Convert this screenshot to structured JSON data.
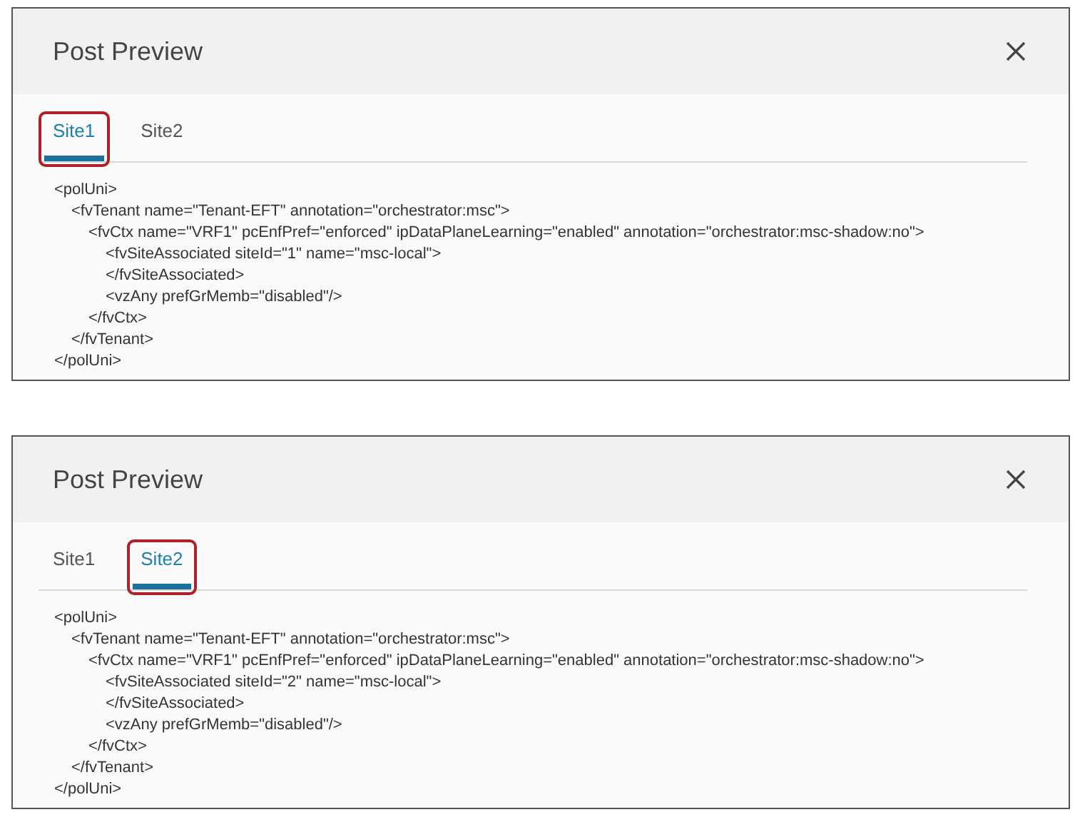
{
  "dialogs": [
    {
      "title": "Post Preview",
      "tabs": [
        {
          "label": "Site1",
          "selected": true,
          "highlighted": true
        },
        {
          "label": "Site2",
          "selected": false,
          "highlighted": false
        }
      ],
      "code": [
        {
          "text": "<polUni>",
          "children": [
            {
              "text": "<fvTenant name=\"Tenant-EFT\" annotation=\"orchestrator:msc\">",
              "children": [
                {
                  "text": "<fvCtx name=\"VRF1\" pcEnfPref=\"enforced\" ipDataPlaneLearning=\"enabled\" annotation=\"orchestrator:msc-shadow:no\">",
                  "children": [
                    {
                      "text": "<fvSiteAssociated siteId=\"1\" name=\"msc-local\">"
                    },
                    {
                      "text": "</fvSiteAssociated>"
                    },
                    {
                      "text": "<vzAny prefGrMemb=\"disabled\"/>"
                    }
                  ]
                },
                {
                  "text": "</fvCtx>"
                }
              ]
            },
            {
              "text": "</fvTenant>"
            }
          ]
        },
        {
          "text": "</polUni>"
        }
      ]
    },
    {
      "title": "Post Preview",
      "tabs": [
        {
          "label": "Site1",
          "selected": false,
          "highlighted": false
        },
        {
          "label": "Site2",
          "selected": true,
          "highlighted": true
        }
      ],
      "code": [
        {
          "text": "<polUni>",
          "children": [
            {
              "text": "<fvTenant name=\"Tenant-EFT\" annotation=\"orchestrator:msc\">",
              "children": [
                {
                  "text": "<fvCtx name=\"VRF1\" pcEnfPref=\"enforced\" ipDataPlaneLearning=\"enabled\" annotation=\"orchestrator:msc-shadow:no\">",
                  "children": [
                    {
                      "text": "<fvSiteAssociated siteId=\"2\" name=\"msc-local\">"
                    },
                    {
                      "text": "</fvSiteAssociated>"
                    },
                    {
                      "text": "<vzAny prefGrMemb=\"disabled\"/>"
                    }
                  ]
                },
                {
                  "text": "</fvCtx>"
                }
              ]
            },
            {
              "text": "</fvTenant>"
            }
          ]
        },
        {
          "text": "</polUni>"
        }
      ]
    }
  ]
}
